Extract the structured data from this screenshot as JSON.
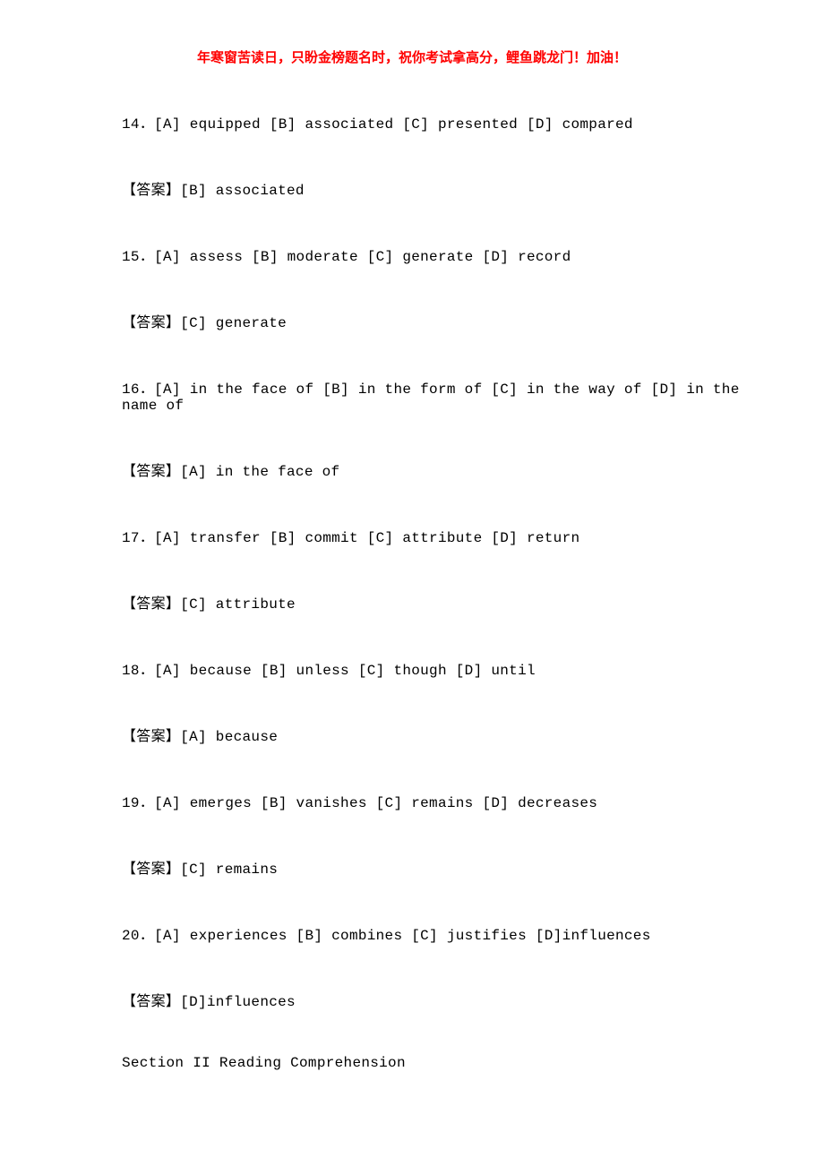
{
  "header": "年寒窗苦读日，只盼金榜题名时，祝你考试拿高分，鲤鱼跳龙门！加油！",
  "answer_label": "【答案】",
  "questions": [
    {
      "num": "14",
      "options": "．[A] equipped [B] associated [C] presented [D] compared",
      "answer": "[B] associated"
    },
    {
      "num": "15",
      "options": "．[A] assess [B] moderate [C] generate [D] record",
      "answer": "[C] generate"
    },
    {
      "num": "16",
      "options": "．[A] in the face of [B] in the form of [C] in the way of [D] in the name of",
      "answer": "[A] in the face of"
    },
    {
      "num": "17",
      "options": "．[A] transfer [B] commit [C] attribute [D] return",
      "answer": "[C] attribute"
    },
    {
      "num": "18",
      "options": "．[A] because [B] unless [C] though [D] until",
      "answer": "[A] because"
    },
    {
      "num": "19",
      "options": "．[A] emerges [B] vanishes [C] remains [D] decreases",
      "answer": "[C] remains"
    },
    {
      "num": "20",
      "options": "．[A] experiences [B] combines [C] justifies [D]influences",
      "answer": "[D]influences"
    }
  ],
  "section": "Section II Reading Comprehension"
}
